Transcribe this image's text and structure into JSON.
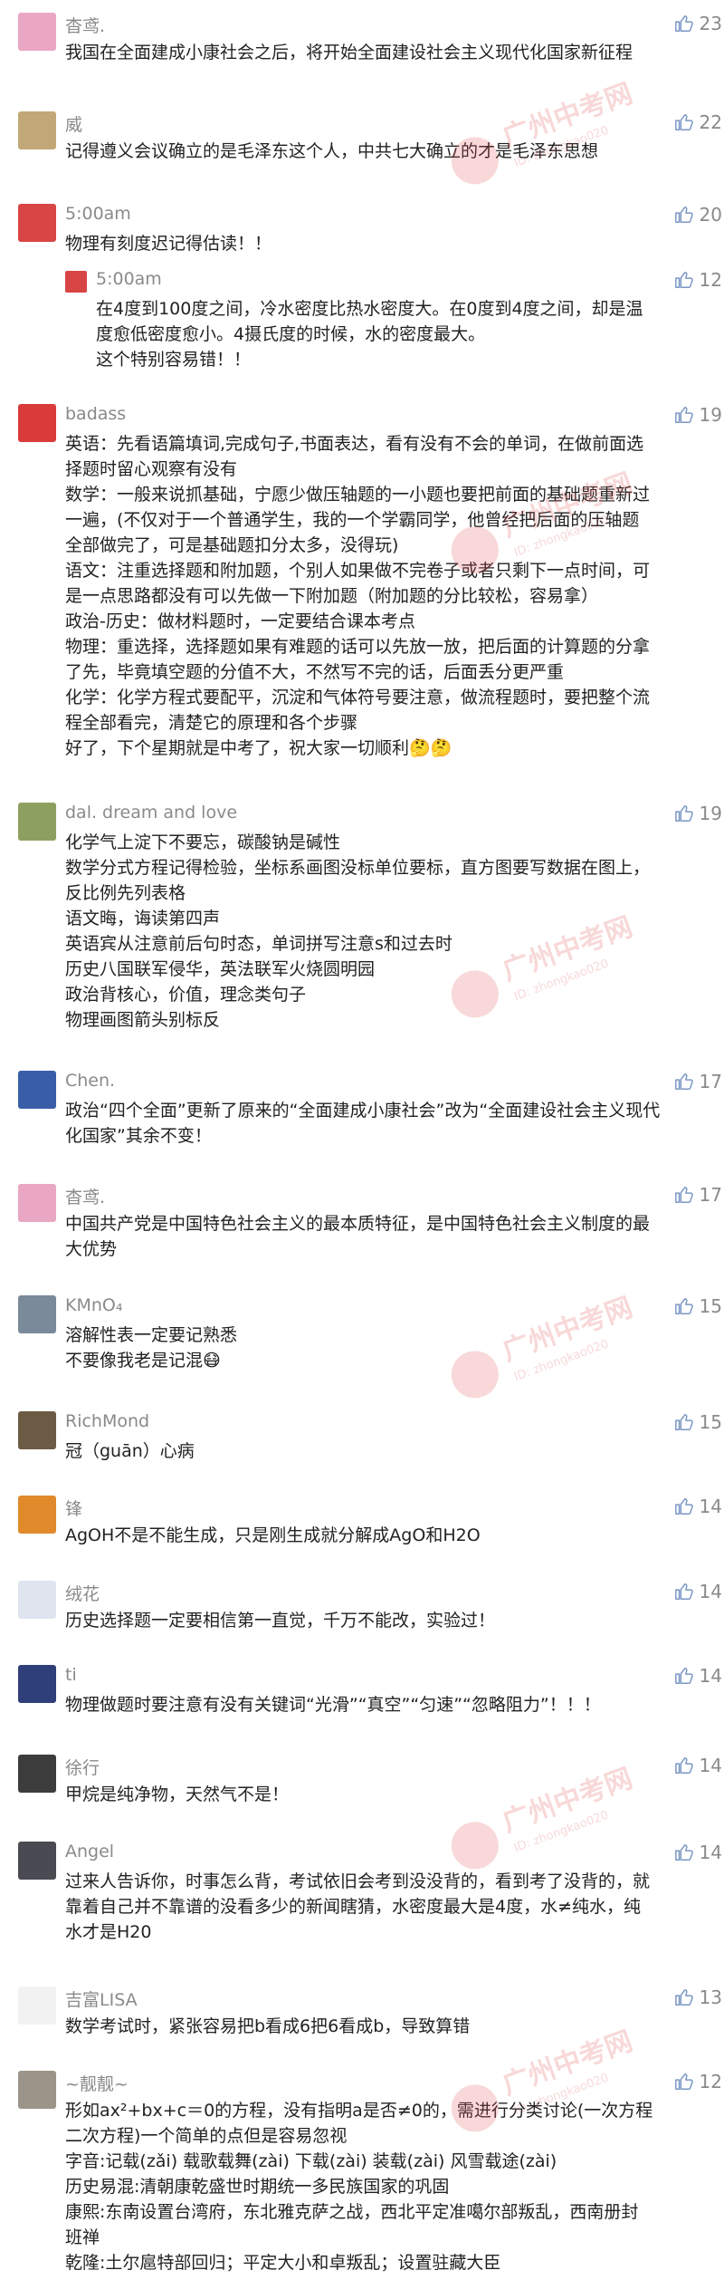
{
  "comments": [
    {
      "name": "杳鸢.",
      "likes": "23",
      "avatar": "#e9a7c3",
      "lines": [
        "我国在全面建成小康社会之后，将开始全面建设社会主义现代化国家新征程"
      ]
    },
    {
      "name": "威",
      "likes": "22",
      "avatar": "#c2a878",
      "lines": [
        "记得遵义会议确立的是毛泽东这个人，中共七大确立的才是毛泽东思想"
      ]
    },
    {
      "name": "5:00am",
      "likes": "20",
      "avatar": "#d84545",
      "lines": [
        "物理有刻度迟记得估读！！"
      ],
      "reply": {
        "name": "5:00am",
        "likes": "12",
        "lines": [
          "在4度到100度之间，冷水密度比热水密度大。在0度到4度之间，却是温",
          "度愈低密度愈小。4摄氏度的时候，水的密度最大。",
          "这个特别容易错！！"
        ]
      }
    },
    {
      "name": "badass",
      "likes": "19",
      "avatar": "#d93b3b",
      "lines": [
        "英语：先看语篇填词,完成句子,书面表达，看有没有不会的单词，在做前面选",
        "择题时留心观察有没有",
        "数学：一般来说抓基础，宁愿少做压轴题的一小题也要把前面的基础题重新过",
        "一遍，(不仅对于一个普通学生，我的一个学霸同学，他曾经把后面的压轴题",
        "全部做完了，可是基础题扣分太多，没得玩)",
        "语文：注重选择题和附加题，个别人如果做不完卷子或者只剩下一点时间，可",
        "是一点思路都没有可以先做一下附加题（附加题的分比较松，容易拿）",
        "政治-历史：做材料题时，一定要结合课本考点",
        "物理：重选择，选择题如果有难题的话可以先放一放，把后面的计算题的分拿",
        "了先，毕竟填空题的分值不大，不然写不完的话，后面丢分更严重",
        "化学：化学方程式要配平，沉淀和气体符号要注意，做流程题时，要把整个流",
        "程全部看完，清楚它的原理和各个步骤",
        "好了，下个星期就是中考了，祝大家一切顺利🤔🤔"
      ]
    },
    {
      "name": "dal. dream and love",
      "likes": "19",
      "avatar": "#8ea060",
      "lines": [
        "化学气上淀下不要忘，碳酸钠是碱性",
        "数学分式方程记得检验，坐标系画图没标单位要标，直方图要写数据在图上，",
        "反比例先列表格",
        "语文晦，诲读第四声",
        "英语宾从注意前后句时态，单词拼写注意s和过去时",
        "历史八国联军侵华，英法联军火烧圆明园",
        "政治背核心，价值，理念类句子",
        "物理画图箭头别标反"
      ]
    },
    {
      "name": "Chen.",
      "likes": "17",
      "avatar": "#3a5da8",
      "lines": [
        "政治“四个全面”更新了原来的“全面建成小康社会”改为“全面建设社会主义现代",
        "化国家”其余不变！"
      ]
    },
    {
      "name": "杳鸢.",
      "likes": "17",
      "avatar": "#e9a7c3",
      "lines": [
        "中国共产党是中国特色社会主义的最本质特征，是中国特色社会主义制度的最",
        "大优势"
      ]
    },
    {
      "name": "KMnO₄",
      "likes": "15",
      "avatar": "#7a8a9a",
      "lines": [
        "溶解性表一定要记熟悉",
        "不要像我老是记混😷"
      ]
    },
    {
      "name": "RichMond",
      "likes": "15",
      "avatar": "#6d5a44",
      "lines": [
        "冠（guān）心病"
      ]
    },
    {
      "name": "锋",
      "likes": "14",
      "avatar": "#e08a2c",
      "lines": [
        "AgOH不是不能生成，只是刚生成就分解成AgO和H2O"
      ]
    },
    {
      "name": "绒花",
      "likes": "14",
      "avatar": "#dfe4ef",
      "lines": [
        "历史选择题一定要相信第一直觉，千万不能改，实验过！"
      ]
    },
    {
      "name": "ti",
      "likes": "14",
      "avatar": "#2f3f7a",
      "lines": [
        "物理做题时要注意有没有关键词“光滑”“真空”“匀速”“忽略阻力”！！！"
      ]
    },
    {
      "name": "徐行",
      "likes": "14",
      "avatar": "#3c3c3c",
      "lines": [
        "甲烷是纯净物，天然气不是！"
      ]
    },
    {
      "name": "Angel",
      "likes": "14",
      "avatar": "#4a4a52",
      "lines": [
        "过来人告诉你，时事怎么背，考试依旧会考到没没背的，看到考了没背的，就",
        "靠着自己并不靠谱的没看多少的新闻瞎猜，水密度最大是4度，水≠纯水，纯",
        "水才是H20"
      ]
    },
    {
      "name": "吉富LISA",
      "likes": "13",
      "avatar": "#f2f2f2",
      "lines": [
        "数学考试时，紧张容易把b看成6把6看成b，导致算错"
      ]
    },
    {
      "name": "~靓靓~",
      "likes": "12",
      "avatar": "#9c9489",
      "lines": [
        "形如ax²+bx+c＝0的方程，没有指明a是否≠0的，需进行分类讨论(一次方程",
        "二次方程)一个简单的点但是容易忽视",
        "字音:记载(zǎi) 载歌载舞(zài) 下载(zài) 装载(zài) 风雪载途(zài)",
        "历史易混:清朝康乾盛世时期统一多民族国家的巩固",
        "康熙:东南设置台湾府，东北雅克萨之战，西北平定准噶尔部叛乱，西南册封",
        "班禅",
        "乾隆:土尔扈特部回归；平定大小和卓叛乱；设置驻藏大臣"
      ]
    }
  ],
  "watermark": {
    "title": "广州中考网",
    "subtitle": "ID: zhongkao020"
  },
  "colors": {
    "text": "#222222",
    "meta": "#8a8a8a",
    "watermark": "#e05050"
  }
}
